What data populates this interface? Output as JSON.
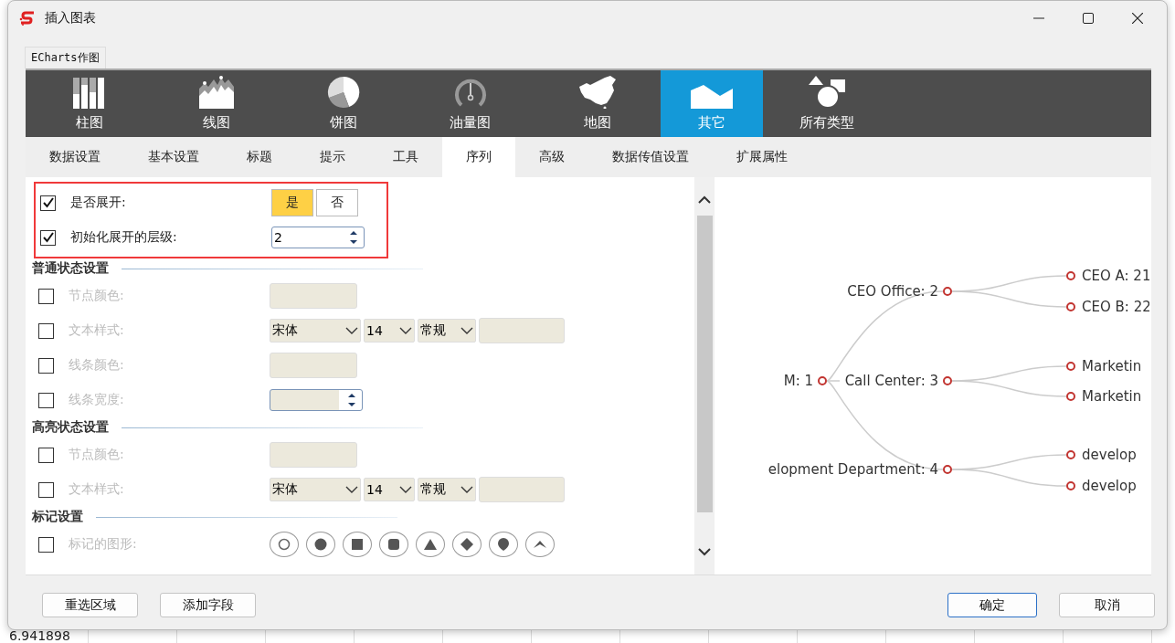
{
  "background": {
    "cell_text": "6.941898"
  },
  "window": {
    "title": "插入图表"
  },
  "outer_tabs": [
    {
      "label": "ECharts作图"
    }
  ],
  "chart_types": [
    {
      "label": "柱图",
      "kind": "bar",
      "selected": false
    },
    {
      "label": "线图",
      "kind": "line",
      "selected": false
    },
    {
      "label": "饼图",
      "kind": "pie",
      "selected": false
    },
    {
      "label": "油量图",
      "kind": "gauge",
      "selected": false
    },
    {
      "label": "地图",
      "kind": "map",
      "selected": false
    },
    {
      "label": "其它",
      "kind": "other",
      "selected": true
    },
    {
      "label": "所有类型",
      "kind": "all",
      "selected": false
    }
  ],
  "settings_tabs": [
    {
      "label": "数据设置",
      "selected": false
    },
    {
      "label": "基本设置",
      "selected": false
    },
    {
      "label": "标题",
      "selected": false
    },
    {
      "label": "提示",
      "selected": false
    },
    {
      "label": "工具",
      "selected": false
    },
    {
      "label": "序列",
      "selected": true
    },
    {
      "label": "高级",
      "selected": false
    },
    {
      "label": "数据传值设置",
      "selected": false
    },
    {
      "label": "扩展属性",
      "selected": false
    }
  ],
  "highlighted_rows": [
    {
      "kind": "toggle",
      "label": "是否展开:",
      "checked": true,
      "options": [
        {
          "label": "是",
          "selected": true
        },
        {
          "label": "否",
          "selected": false
        }
      ]
    },
    {
      "kind": "spinner",
      "label": "初始化展开的层级:",
      "checked": true,
      "value": "2"
    }
  ],
  "sections": [
    {
      "title": "普通状态设置",
      "rows": [
        {
          "kind": "color",
          "label": "节点颜色:",
          "checked": false
        },
        {
          "kind": "font",
          "label": "文本样式:",
          "checked": false,
          "font": "宋体",
          "size": "14",
          "style": "常规"
        },
        {
          "kind": "color",
          "label": "线条颜色:",
          "checked": false
        },
        {
          "kind": "spinner",
          "label": "线条宽度:",
          "checked": false
        }
      ]
    },
    {
      "title": "高亮状态设置",
      "rows": [
        {
          "kind": "color",
          "label": "节点颜色:",
          "checked": false
        },
        {
          "kind": "font",
          "label": "文本样式:",
          "checked": false,
          "font": "宋体",
          "size": "14",
          "style": "常规"
        }
      ]
    },
    {
      "title": "标记设置",
      "rows": [
        {
          "kind": "markers",
          "label": "标记的图形:",
          "checked": false,
          "markers": [
            {
              "kind": "empty-circle"
            },
            {
              "kind": "circle"
            },
            {
              "kind": "rect"
            },
            {
              "kind": "round-rect"
            },
            {
              "kind": "triangle"
            },
            {
              "kind": "diamond"
            },
            {
              "kind": "pin"
            },
            {
              "kind": "arrow"
            }
          ]
        }
      ]
    }
  ],
  "preview": {
    "tree": {
      "label": "M: 1",
      "children": [
        {
          "label": "CEO Office: 2",
          "children": [
            {
              "label": "CEO A: 21"
            },
            {
              "label": "CEO B: 22"
            }
          ]
        },
        {
          "label": "Call Center: 3",
          "children": [
            {
              "label": "Marketin"
            },
            {
              "label": "Marketin"
            }
          ]
        },
        {
          "label": "elopment Department: 4",
          "children": [
            {
              "label": "develop"
            },
            {
              "label": "develop"
            }
          ]
        }
      ]
    }
  },
  "buttons_left": [
    "重选区域",
    "添加字段"
  ],
  "buttons_right": [
    {
      "label": "确定",
      "primary": true
    },
    {
      "label": "取消",
      "primary": false
    }
  ]
}
